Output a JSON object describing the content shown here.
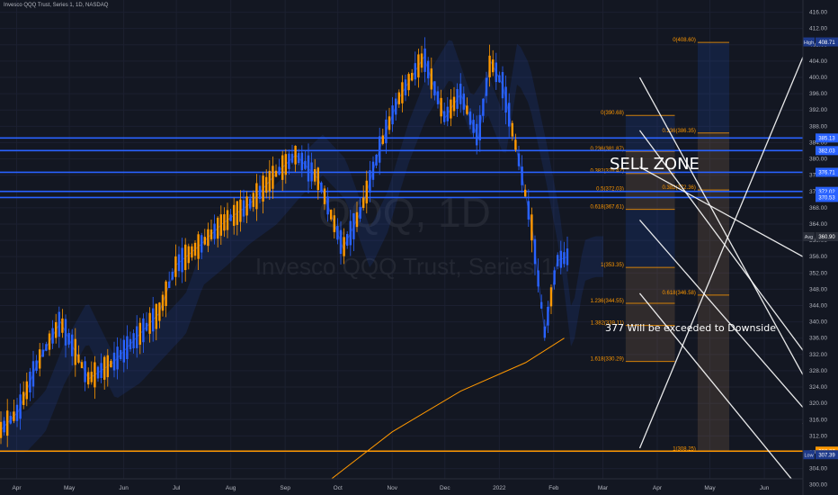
{
  "header": {
    "title": "Invesco QQQ Trust, Series 1, 1D, NASDAQ"
  },
  "watermark": {
    "ticker": "QQQ, 1D",
    "name": "Invesco QQQ Trust, Series 1"
  },
  "annotations": {
    "sell_zone": "SELL ZONE",
    "downside_note": "377 Will be exceeded to Downside"
  },
  "colors": {
    "background": "#131722",
    "candle_up": "#2962ff",
    "candle_down": "#ff9800",
    "price_line": "#2962ff",
    "level_line": "#ff9800",
    "trend_line": "#ffffff",
    "ma_line": "#ff9800",
    "cloud_fill": "#2962ff"
  },
  "chart_data": {
    "type": "candlestick",
    "symbol": "QQQ",
    "timeframe": "1D",
    "exchange": "NASDAQ",
    "x_ticks": [
      "Apr",
      "May",
      "Jun",
      "Jul",
      "Aug",
      "Sep",
      "Oct",
      "Nov",
      "Dec",
      "2022",
      "Feb",
      "Mar",
      "Apr",
      "May",
      "Jun"
    ],
    "y_ticks": [
      300,
      304,
      308,
      312,
      316,
      320,
      324,
      328,
      332,
      336,
      340,
      344,
      348,
      352,
      356,
      360,
      364,
      368,
      372,
      376,
      380,
      384,
      388,
      392,
      396,
      400,
      404,
      408,
      412,
      416
    ],
    "ylim": [
      297.5,
      419
    ],
    "series": [
      {
        "name": "QQQ",
        "anchors": [
          {
            "x": "Mar 22",
            "y": 313
          },
          {
            "x": "Apr 2",
            "y": 318
          },
          {
            "x": "Apr 13",
            "y": 330
          },
          {
            "x": "Apr 26",
            "y": 340
          },
          {
            "x": "May 12",
            "y": 326
          },
          {
            "x": "May 26",
            "y": 330
          },
          {
            "x": "Jun 8",
            "y": 336
          },
          {
            "x": "Jun 21",
            "y": 342
          },
          {
            "x": "Jul 1",
            "y": 354
          },
          {
            "x": "Jul 15",
            "y": 359
          },
          {
            "x": "Jul 27",
            "y": 364
          },
          {
            "x": "Aug 12",
            "y": 369
          },
          {
            "x": "Aug 26",
            "y": 376
          },
          {
            "x": "Sep 7",
            "y": 381
          },
          {
            "x": "Sep 20",
            "y": 375
          },
          {
            "x": "Oct 4",
            "y": 358
          },
          {
            "x": "Oct 14",
            "y": 367
          },
          {
            "x": "Oct 26",
            "y": 384
          },
          {
            "x": "Nov 5",
            "y": 395
          },
          {
            "x": "Nov 19",
            "y": 405
          },
          {
            "x": "Dec 1",
            "y": 390
          },
          {
            "x": "Dec 10",
            "y": 396
          },
          {
            "x": "Dec 20",
            "y": 385
          },
          {
            "x": "Dec 27",
            "y": 404
          },
          {
            "x": "Jan 3",
            "y": 398
          },
          {
            "x": "Jan 13",
            "y": 378
          },
          {
            "x": "Jan 20",
            "y": 362
          },
          {
            "x": "Jan 27",
            "y": 337
          },
          {
            "x": "Feb 3",
            "y": 355
          },
          {
            "x": "Feb 9",
            "y": 356
          }
        ]
      }
    ],
    "horizontal_levels": [
      {
        "value": 385.13,
        "color": "#2962ff"
      },
      {
        "value": 382.03,
        "color": "#2962ff"
      },
      {
        "value": 376.71,
        "color": "#2962ff"
      },
      {
        "value": 372.02,
        "color": "#2962ff"
      },
      {
        "value": 370.53,
        "color": "#2962ff"
      },
      {
        "value": 308.27,
        "color": "#ff9800"
      }
    ],
    "price_labels": [
      {
        "value": 408.71,
        "tag": "High",
        "color": "#1e3a8a"
      },
      {
        "value": 385.13,
        "color": "#2962ff"
      },
      {
        "value": 382.03,
        "color": "#2962ff"
      },
      {
        "value": 376.71,
        "color": "#2962ff"
      },
      {
        "value": 372.02,
        "color": "#2962ff"
      },
      {
        "value": 370.53,
        "color": "#2962ff"
      },
      {
        "value": 360.9,
        "tag": "Avg",
        "color": "#2a2e39"
      },
      {
        "value": 308.27,
        "color": "#ff9800"
      },
      {
        "value": 307.39,
        "tag": "Low",
        "color": "#1e3a8a"
      }
    ],
    "fib_levels": [
      {
        "label": "0(390.68)",
        "x": "Apr 11",
        "value": 390.68
      },
      {
        "label": "0.236(381.87)",
        "x": "Mar 14",
        "value": 381.87
      },
      {
        "label": "0.382(376.42)",
        "x": "Mar 14",
        "value": 376.42
      },
      {
        "label": "0.5(372.03)",
        "x": "Mar 14",
        "value": 372.03
      },
      {
        "label": "0.618(367.61)",
        "x": "Mar 14",
        "value": 367.61
      },
      {
        "label": "1(353.35)",
        "x": "Mar 14",
        "value": 353.35
      },
      {
        "label": "1.236(344.55)",
        "x": "Mar 14",
        "value": 344.55
      },
      {
        "label": "1.382(339.11)",
        "x": "Mar 14",
        "value": 339.11
      },
      {
        "label": "1.618(330.29)",
        "x": "Mar 14",
        "value": 330.29
      },
      {
        "label": "0(408.60)",
        "x": "May 12",
        "value": 408.6
      },
      {
        "label": "0.236(386.35)",
        "x": "Apr 24",
        "value": 386.35
      },
      {
        "label": "0.382(372.36)",
        "x": "Apr 24",
        "value": 372.36
      },
      {
        "label": "0.618(346.58)",
        "x": "Apr 24",
        "value": 346.58
      },
      {
        "label": "1(308.25)",
        "x": "May 12",
        "value": 308.25
      }
    ],
    "trend_lines": [
      {
        "from": {
          "x": "Mar 22",
          "y": 309
        },
        "to": {
          "x": "Jun 23",
          "y": 405
        }
      },
      {
        "from": {
          "x": "Mar 22",
          "y": 400
        },
        "to": {
          "x": "Jun 23",
          "y": 327
        }
      },
      {
        "from": {
          "x": "Mar 22",
          "y": 378
        },
        "to": {
          "x": "Jun 23",
          "y": 356
        }
      },
      {
        "from": {
          "x": "Mar 22",
          "y": 365
        },
        "to": {
          "x": "Jun 23",
          "y": 319
        }
      },
      {
        "from": {
          "x": "Mar 22",
          "y": 347
        },
        "to": {
          "x": "Jun 23",
          "y": 298
        }
      },
      {
        "from": {
          "x": "Jul 26",
          "y": 420
        },
        "to": {
          "x": "Jun 23",
          "y": 315
        }
      },
      {
        "from": {
          "x": "Mar 22",
          "y": 387
        },
        "to": {
          "x": "Jun 23",
          "y": 333
        }
      }
    ],
    "moving_average": [
      {
        "x": "Sep 23",
        "y": 300
      },
      {
        "x": "Nov 1",
        "y": 313
      },
      {
        "x": "Dec 10",
        "y": 323
      },
      {
        "x": "Jan 16",
        "y": 330
      },
      {
        "x": "Feb 7",
        "y": 336
      }
    ],
    "legend": "none",
    "grid": true
  }
}
